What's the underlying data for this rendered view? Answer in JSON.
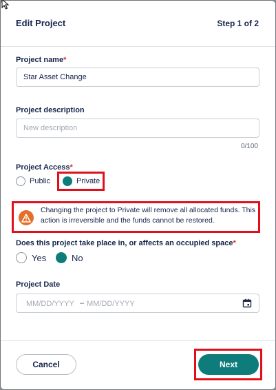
{
  "dialog": {
    "title": "Edit Project",
    "step": "Step 1 of 2"
  },
  "project_name": {
    "label": "Project name",
    "required_mark": "*",
    "value": "Star Asset Change"
  },
  "project_description": {
    "label": "Project description",
    "placeholder": "New description",
    "counter": "0/100"
  },
  "project_access": {
    "label": "Project Access",
    "required_mark": "*",
    "options": [
      {
        "label": "Public",
        "selected": false
      },
      {
        "label": "Private",
        "selected": true
      }
    ]
  },
  "warning": {
    "icon": "warning-triangle-icon",
    "text": "Changing the project to Private will remove all allocated funds. This action is irreversible and the funds cannot be restored."
  },
  "occupied_space": {
    "label": "Does this project take place in, or affects an occupied space",
    "required_mark": "*",
    "options": [
      {
        "label": "Yes",
        "selected": false
      },
      {
        "label": "No",
        "selected": true
      }
    ]
  },
  "project_date": {
    "label": "Project Date",
    "start_placeholder": "MM/DD/YYYY",
    "separator": "–",
    "end_placeholder": "MM/DD/YYYY",
    "icon": "calendar-icon"
  },
  "footer": {
    "cancel_label": "Cancel",
    "next_label": "Next"
  },
  "colors": {
    "accent": "#0e7c7b",
    "highlight_border": "#e10f1a",
    "warning": "#e2702a",
    "required": "#d32f2f"
  }
}
